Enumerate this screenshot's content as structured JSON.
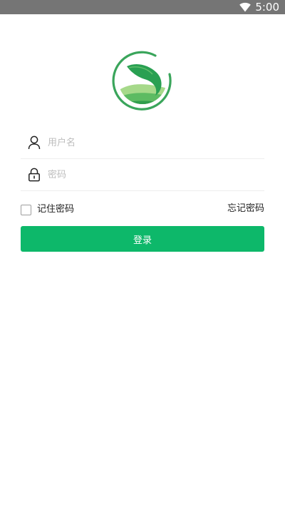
{
  "status_bar": {
    "time": "5:00",
    "wifi_icon": "wifi-icon"
  },
  "logo": {
    "icon": "leaf-logo-icon",
    "colors": {
      "ring": "#3aa55b",
      "leaf": "#29a052",
      "hill_light": "#a6d98a",
      "hill_dark": "#2f9d4c"
    }
  },
  "form": {
    "username": {
      "icon": "user-icon",
      "value": "",
      "placeholder": "用户名"
    },
    "password": {
      "icon": "lock-icon",
      "value": "",
      "placeholder": "密码"
    }
  },
  "options": {
    "remember_label": "记住密码",
    "remember_checked": false,
    "forgot_label": "忘记密码"
  },
  "login_button": {
    "label": "登录",
    "color": "#0db86a"
  }
}
